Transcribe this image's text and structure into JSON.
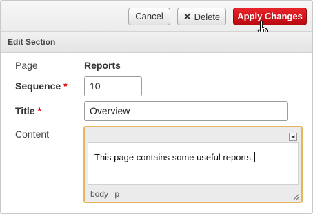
{
  "toolbar": {
    "cancel_label": "Cancel",
    "delete_label": "Delete",
    "delete_icon": "x-icon",
    "apply_label": "Apply Changes",
    "apply_color": "#d8161d"
  },
  "section": {
    "title": "Edit Section"
  },
  "form": {
    "page_label": "Page",
    "page_value": "Reports",
    "sequence_label": "Sequence",
    "sequence_value": "10",
    "title_label": "Title",
    "title_value": "Overview",
    "content_label": "Content",
    "required_mark": "*",
    "required_color": "#dd0000"
  },
  "editor": {
    "content_text": "This page contains some useful reports.",
    "path_elements": [
      "body",
      "p"
    ],
    "focus_border_color": "#e7b65a",
    "collapse_icon": "collapse-toolbar-icon",
    "resize_icon": "resize-grip-icon"
  }
}
